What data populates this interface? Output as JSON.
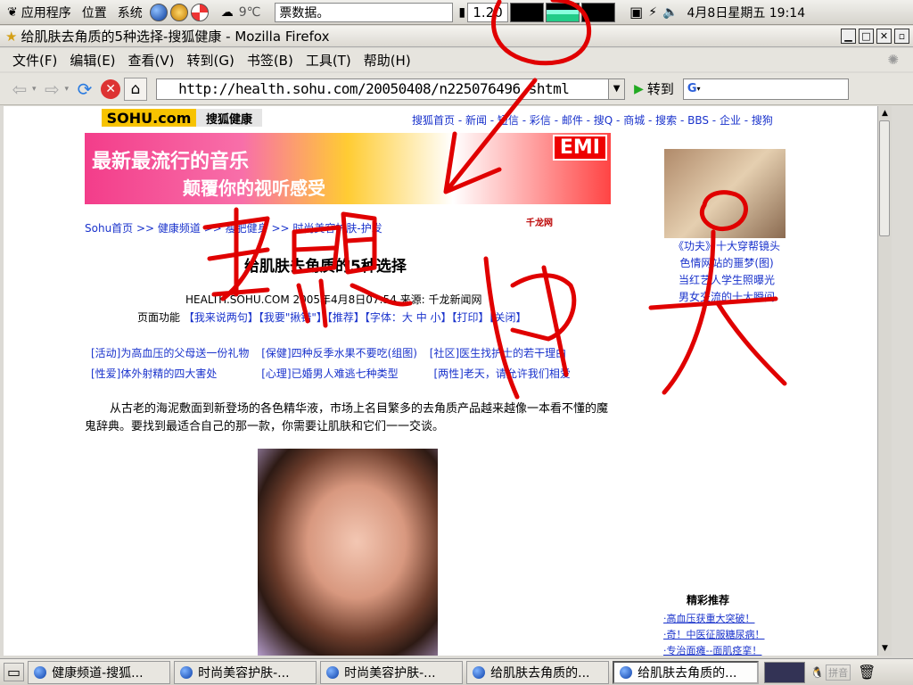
{
  "panel": {
    "apps": "应用程序",
    "places": "位置",
    "system": "系统",
    "weather": "9℃",
    "ticker": "票数据。",
    "cpu": "1.20",
    "datetime": "4月8日星期五 19:14"
  },
  "window": {
    "title": "给肌肤去角质的5种选择-搜狐健康 - Mozilla Firefox"
  },
  "menu": [
    "文件(F)",
    "编辑(E)",
    "查看(V)",
    "转到(G)",
    "书签(B)",
    "工具(T)",
    "帮助(H)"
  ],
  "nav": {
    "url": "http://health.sohu.com/20050408/n225076496.shtml",
    "go": "转到",
    "search_placeholder": "G"
  },
  "page": {
    "logo": "SOHU.com",
    "logo_sub": "搜狐健康",
    "top_links": "搜狐首页 - 新闻 - 短信 - 彩信 - 邮件 - 搜Q - 商城 - 搜索 - BBS - 企业 - 搜狗",
    "banner_line1": "最新最流行的音乐",
    "banner_line2": "颠覆你的视听感受",
    "banner_brand": "EMI",
    "breadcrumb": "Sohu首页 >> 健康频道 >> 瘦肥健身 >> 时尚美容护肤-护发",
    "partner": "千龙网",
    "article_title": "给肌肤去角质的5种选择",
    "article_meta": "HEALTH.SOHU.COM 2005年4月8日07:54  来源: 千龙新闻网",
    "func_label": "页面功能",
    "func_links": "【我来说两句】【我要\"揪错\"】【推荐】【字体：大 中 小】【打印】【关闭】",
    "ads": [
      {
        "tag": "[活动]",
        "text": "为高血压的父母送一份礼物"
      },
      {
        "tag": "[保健]",
        "text": "四种反季水果不要吃(组图)"
      },
      {
        "tag": "[社区]",
        "text": "医生找护士的若干理由"
      },
      {
        "tag": "[性爱]",
        "text": "体外射精的四大害处"
      },
      {
        "tag": "[心理]",
        "text": "已婚男人难逃七种类型"
      },
      {
        "tag": "[两性]",
        "text": "老天，请允许我们相爱"
      }
    ],
    "paragraph": "从古老的海泥敷面到新登场的各色精华液，市场上名目繁多的去角质产品越来越像一本看不懂的魔鬼辞典。要找到最适合自己的那一款，你需要让肌肤和它们一一交谈。",
    "side_links": [
      "《功夫》十大穿帮镜头",
      "色情网站的噩梦(图)",
      "当红艺人学生照曝光",
      "男女交流的十大瞬间"
    ],
    "rec_title": "精彩推荐",
    "rec_links": [
      "·高血压获重大突破！",
      "·奇！中医征服糖尿病！",
      "·专治面瘫--面肌痉挛！"
    ]
  },
  "taskbar": [
    {
      "label": "健康频道-搜狐...",
      "active": false
    },
    {
      "label": "时尚美容护肤-...",
      "active": false
    },
    {
      "label": "时尚美容护肤-...",
      "active": false
    },
    {
      "label": "给肌肤去角质的...",
      "active": false
    },
    {
      "label": "给肌肤去角质的...",
      "active": true
    }
  ],
  "tray": {
    "ime": "拼音"
  },
  "colors": {
    "link": "#1a33cc",
    "annotation": "#e00000",
    "logo": "#f7c300"
  }
}
